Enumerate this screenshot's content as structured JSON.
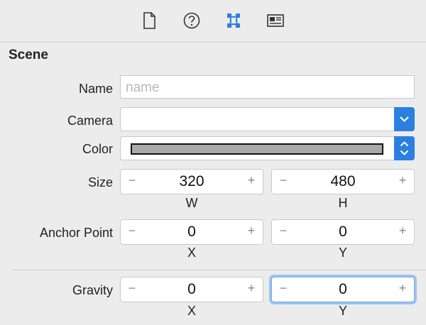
{
  "toolbar": {
    "buttons": [
      {
        "icon": "file-inspector-icon"
      },
      {
        "icon": "quick-help-icon"
      },
      {
        "icon": "attributes-inspector-icon",
        "selected": true
      },
      {
        "icon": "size-inspector-icon"
      }
    ],
    "accent_color": "#2b7fe0"
  },
  "section": {
    "title": "Scene"
  },
  "name": {
    "label": "Name",
    "placeholder": "name",
    "value": ""
  },
  "camera": {
    "label": "Camera",
    "value": ""
  },
  "color": {
    "label": "Color",
    "swatch": "#a9a9a9"
  },
  "size": {
    "label": "Size",
    "w": "320",
    "h": "480",
    "w_label": "W",
    "h_label": "H"
  },
  "anchor": {
    "label": "Anchor Point",
    "x": "0",
    "y": "0",
    "x_label": "X",
    "y_label": "Y"
  },
  "gravity": {
    "label": "Gravity",
    "x": "0",
    "y": "0",
    "x_label": "X",
    "y_label": "Y"
  },
  "stepper": {
    "minus": "−",
    "plus": "+"
  }
}
